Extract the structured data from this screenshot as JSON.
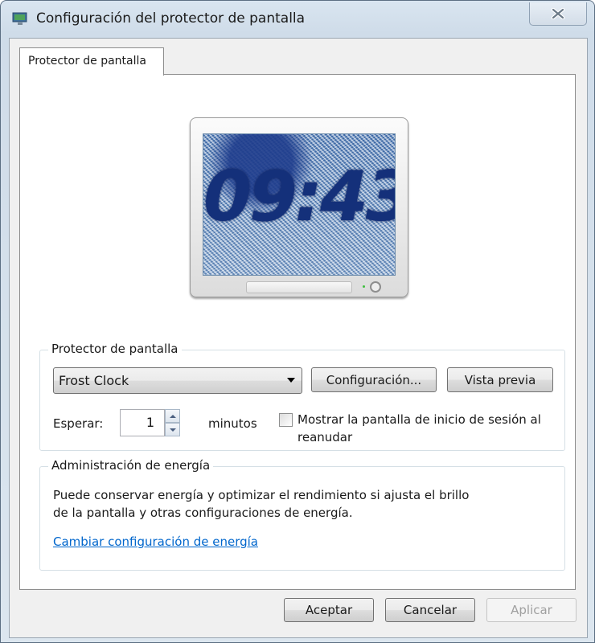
{
  "window": {
    "title": "Configuración del protector de pantalla",
    "app_icon": "display-settings-icon",
    "close_icon": "close-icon"
  },
  "tabs": [
    {
      "label": "Protector de pantalla",
      "active": true
    }
  ],
  "preview": {
    "clock_time": "09:43"
  },
  "screensaver_group": {
    "legend": "Protector de pantalla",
    "selected_screensaver": "Frost Clock",
    "settings_button": "Configuración...",
    "preview_button": "Vista previa",
    "wait_label": "Esperar:",
    "wait_value": "1",
    "minutes_label": "minutos",
    "logon_checkbox_label": "Mostrar la pantalla de inicio de sesión al reanudar",
    "logon_checkbox_checked": false
  },
  "power_group": {
    "legend": "Administración de energía",
    "description": "Puede conservar energía y optimizar el rendimiento si ajusta el brillo de la pantalla y otras configuraciones de energía.",
    "link": "Cambiar configuración de energía"
  },
  "footer": {
    "ok": "Aceptar",
    "cancel": "Cancelar",
    "apply": "Aplicar",
    "apply_enabled": false
  }
}
